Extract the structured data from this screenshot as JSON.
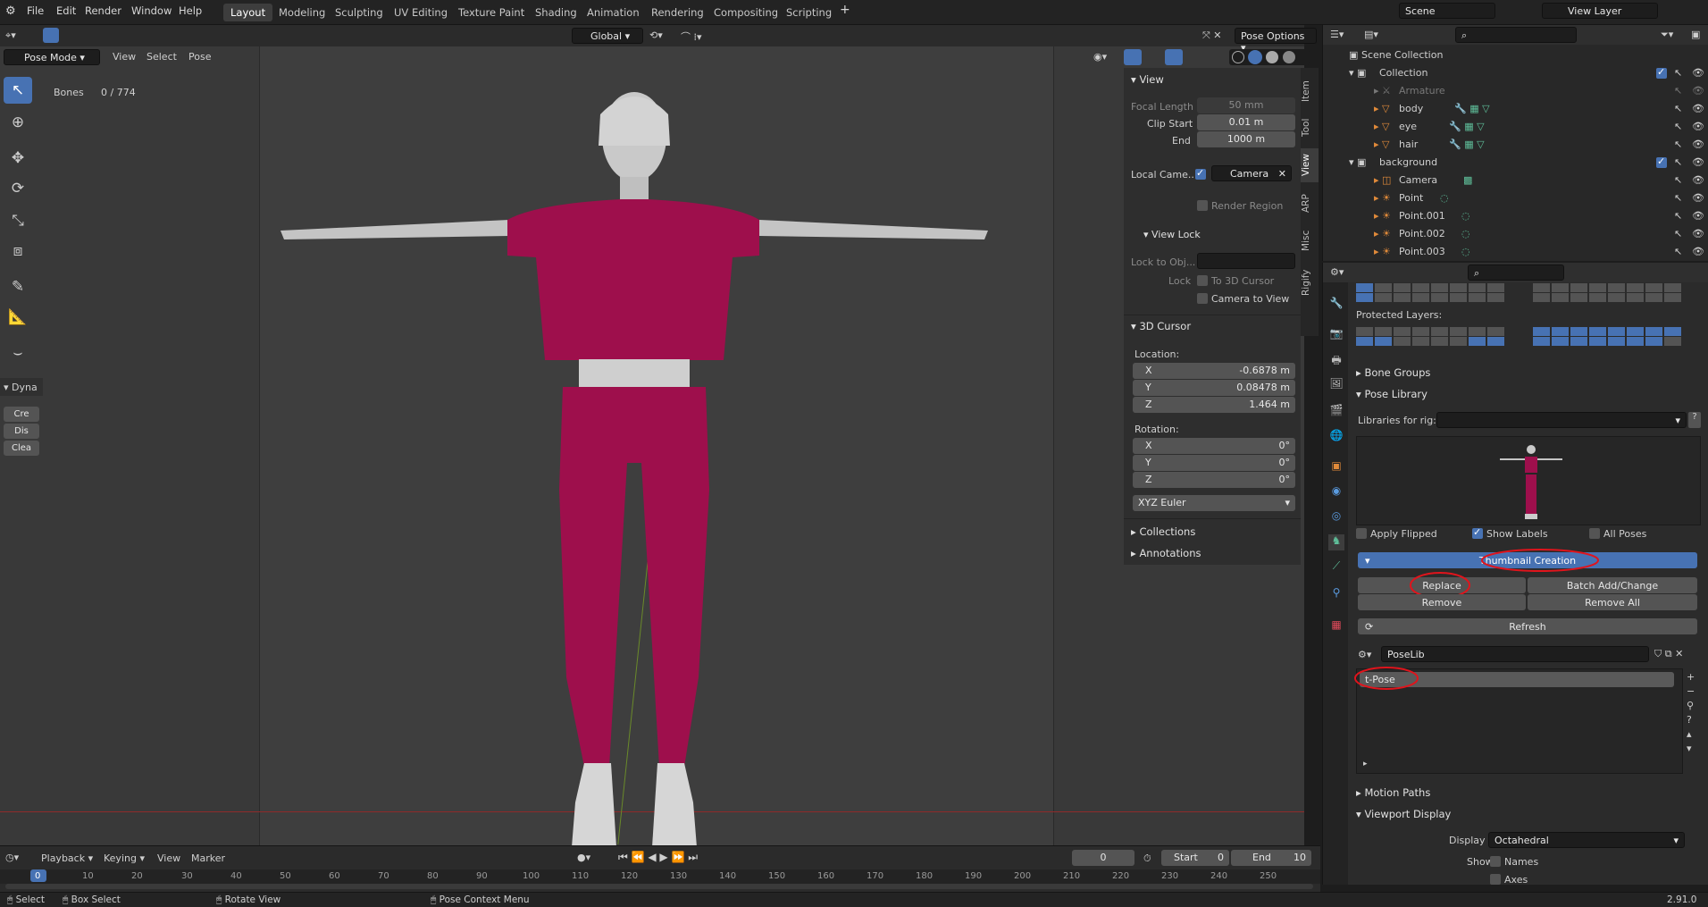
{
  "menus": [
    "File",
    "Edit",
    "Render",
    "Window",
    "Help"
  ],
  "workspaces": [
    "Layout",
    "Modeling",
    "Sculpting",
    "UV Editing",
    "Texture Paint",
    "Shading",
    "Animation",
    "Rendering",
    "Compositing",
    "Scripting"
  ],
  "scene": {
    "label": "Scene",
    "view_layer": "View Layer"
  },
  "viewport_header": {
    "transform_orient": "Global",
    "pose_options": "Pose Options",
    "mode": "Pose Mode",
    "menus": [
      "View",
      "Select",
      "Pose"
    ]
  },
  "overlay_info": {
    "bones_label": "Bones",
    "bones_value": "0 / 774"
  },
  "dyna_panel": {
    "title": "Dyna",
    "items": [
      "Cre",
      "Dis",
      "Clea"
    ]
  },
  "npanel": {
    "tabs": [
      "Item",
      "Tool",
      "View",
      "ARP",
      "Misc",
      "Rigify"
    ],
    "view": {
      "title": "View",
      "focal_length_label": "Focal Length",
      "focal_length": "50 mm",
      "clip_start_label": "Clip Start",
      "clip_start": "0.01 m",
      "end_label": "End",
      "end": "1000 m",
      "local_camera_label": "Local Came...",
      "camera": "Camera",
      "render_region": "Render Region"
    },
    "view_lock": {
      "title": "View Lock",
      "lock_to_obj_label": "Lock to Obj...",
      "lock_label": "Lock",
      "to_3d_cursor": "To 3D Cursor",
      "camera_to_view": "Camera to View"
    },
    "cursor": {
      "title": "3D Cursor",
      "location_label": "Location:",
      "x": "-0.6878 m",
      "y": "0.08478 m",
      "z": "1.464 m",
      "rotation_label": "Rotation:",
      "rx": "0°",
      "ry": "0°",
      "rz": "0°",
      "rotation_mode": "XYZ Euler",
      "axis_x": "X",
      "axis_y": "Y",
      "axis_z": "Z"
    },
    "collections": "Collections",
    "annotations": "Annotations"
  },
  "outliner": {
    "root": "Scene Collection",
    "rows": [
      {
        "name": "Collection",
        "indent": 1
      },
      {
        "name": "Armature",
        "indent": 2
      },
      {
        "name": "body",
        "indent": 2
      },
      {
        "name": "eye",
        "indent": 2
      },
      {
        "name": "hair",
        "indent": 2
      },
      {
        "name": "background",
        "indent": 1
      },
      {
        "name": "Camera",
        "indent": 2
      },
      {
        "name": "Point",
        "indent": 2
      },
      {
        "name": "Point.001",
        "indent": 2
      },
      {
        "name": "Point.002",
        "indent": 2
      },
      {
        "name": "Point.003",
        "indent": 2
      }
    ]
  },
  "properties": {
    "protected_layers": "Protected Layers:",
    "bone_groups": "Bone Groups",
    "pose_library": "Pose Library",
    "libraries_for_rig": "Libraries for rig:",
    "apply_flipped": "Apply Flipped",
    "show_labels": "Show Labels",
    "all_poses": "All Poses",
    "thumbnail_creation": "Thumbnail Creation",
    "replace": "Replace",
    "batch_add": "Batch Add/Change",
    "remove": "Remove",
    "remove_all": "Remove All",
    "refresh": "Refresh",
    "poselib_name": "PoseLib",
    "pose_item": "t-Pose",
    "motion_paths": "Motion Paths",
    "viewport_display": "Viewport Display",
    "display_as_label": "Display As",
    "display_as": "Octahedral",
    "show_label": "Show",
    "names": "Names",
    "axes": "Axes"
  },
  "timeline": {
    "menus": [
      "Playback",
      "Keying",
      "View",
      "Marker"
    ],
    "current_frame": "0",
    "start_label": "Start",
    "start": "0",
    "end_label": "End",
    "end": "10",
    "ruler": [
      "0",
      "10",
      "20",
      "30",
      "40",
      "50",
      "60",
      "70",
      "80",
      "90",
      "100",
      "110",
      "120",
      "130",
      "140",
      "150",
      "160",
      "170",
      "180",
      "190",
      "200",
      "210",
      "220",
      "230",
      "240",
      "250"
    ]
  },
  "statusbar": {
    "select": "Select",
    "box_select": "Box Select",
    "rotate_view": "Rotate View",
    "pose_context": "Pose Context Menu",
    "version": "2.91.0"
  },
  "colors": {
    "accent": "#4772b3",
    "outfit": "#9e0f4c",
    "annotation_red": "#e0141c"
  }
}
